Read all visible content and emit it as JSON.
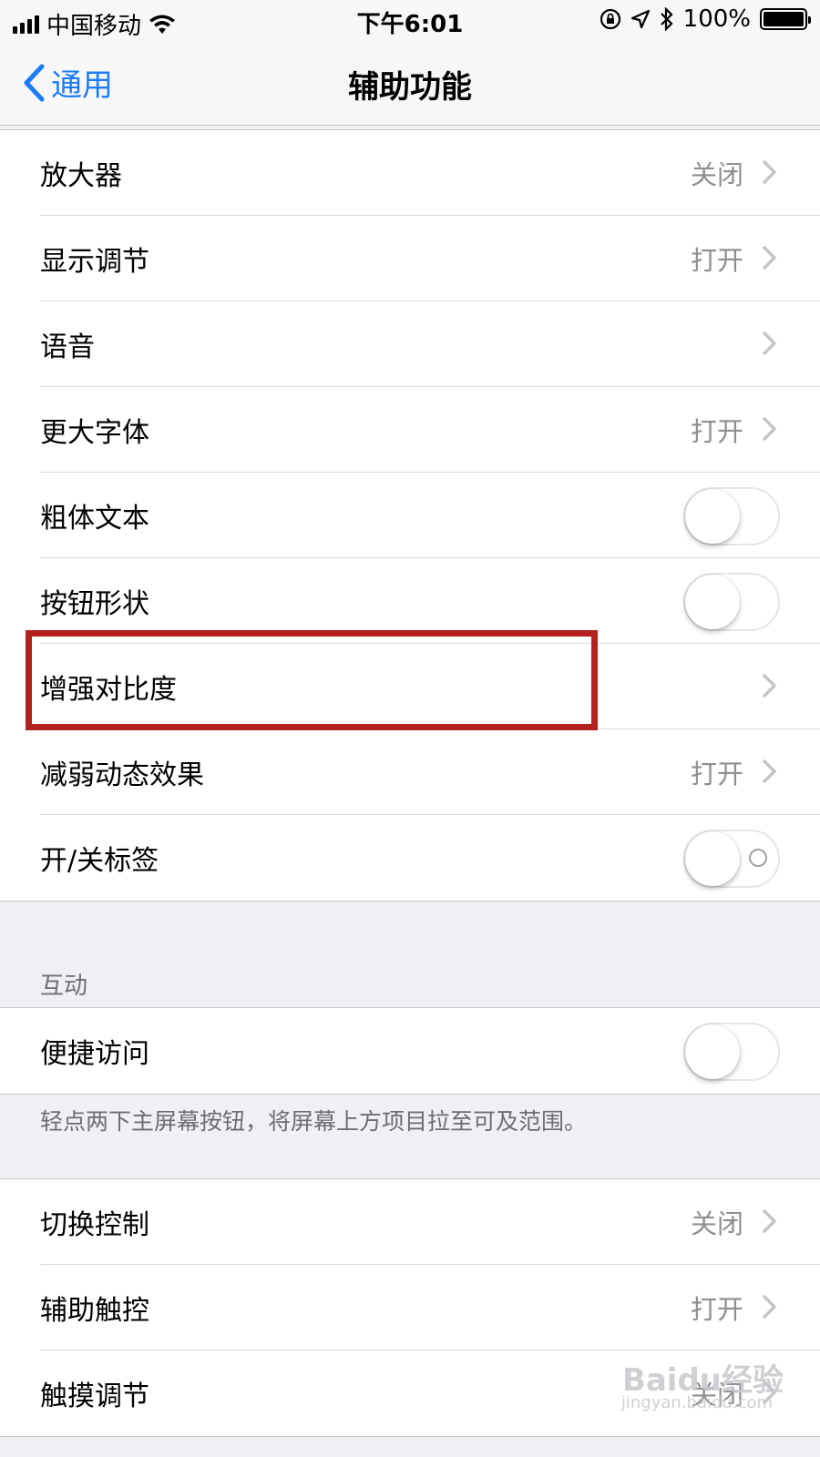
{
  "status_bar": {
    "carrier": "中国移动",
    "time": "下午6:01",
    "battery": "100%",
    "icons": [
      "signal-icon",
      "wifi-icon",
      "orientation-lock-icon",
      "location-icon",
      "bluetooth-icon",
      "battery-icon"
    ]
  },
  "nav": {
    "back_label": "通用",
    "title": "辅助功能"
  },
  "vision_rows": [
    {
      "label": "放大器",
      "value": "关闭",
      "type": "disclosure"
    },
    {
      "label": "显示调节",
      "value": "打开",
      "type": "disclosure"
    },
    {
      "label": "语音",
      "value": "",
      "type": "disclosure"
    },
    {
      "label": "更大字体",
      "value": "打开",
      "type": "disclosure"
    },
    {
      "label": "粗体文本",
      "type": "switch",
      "on": false
    },
    {
      "label": "按钮形状",
      "type": "switch",
      "on": false
    },
    {
      "label": "增强对比度",
      "value": "",
      "type": "disclosure"
    },
    {
      "label": "减弱动态效果",
      "value": "打开",
      "type": "disclosure"
    },
    {
      "label": "开/关标签",
      "type": "switch",
      "on": false
    }
  ],
  "interaction": {
    "header": "互动",
    "row": {
      "label": "便捷访问",
      "type": "switch",
      "on": false
    },
    "footer": "轻点两下主屏幕按钮，将屏幕上方项目拉至可及范围。"
  },
  "more_rows": [
    {
      "label": "切换控制",
      "value": "关闭",
      "type": "disclosure"
    },
    {
      "label": "辅助触控",
      "value": "打开",
      "type": "disclosure"
    },
    {
      "label": "触摸调节",
      "value": "关闭",
      "type": "disclosure"
    }
  ],
  "watermark": {
    "logo": "Baidu经验",
    "url": "jingyan.baidu.com"
  },
  "colors": {
    "accent": "#1a7cfb",
    "highlight": "#b3211c",
    "secondary_text": "#8e8e93"
  }
}
